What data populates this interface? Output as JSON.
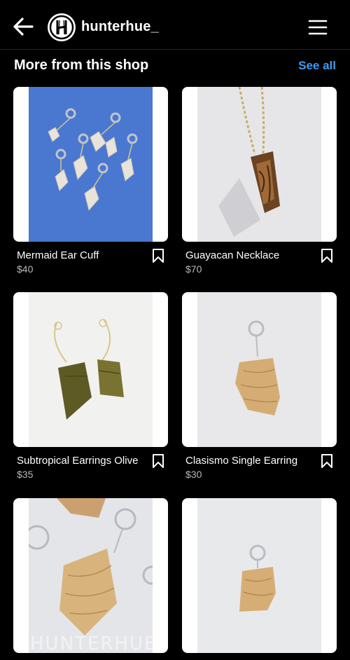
{
  "header": {
    "back_icon": "arrow-left-icon",
    "username": "hunterhue_",
    "avatar_icon": "shop-logo-icon",
    "menu_icon": "hamburger-menu-icon"
  },
  "section": {
    "title": "More from this shop",
    "see_all": "See all",
    "accent_color": "#3d9cf3"
  },
  "products": [
    {
      "name": "Mermaid Ear Cuff",
      "price": "$40",
      "save_icon": "bookmark-icon"
    },
    {
      "name": "Guayacan Necklace",
      "price": "$70",
      "save_icon": "bookmark-icon"
    },
    {
      "name": "Subtropical Earrings Olive",
      "price": "$35",
      "save_icon": "bookmark-icon"
    },
    {
      "name": "Clasismo Single Earring",
      "price": "$30",
      "save_icon": "bookmark-icon"
    },
    {
      "name": "",
      "price": "",
      "watermark": "HUNTERHUE"
    },
    {
      "name": "",
      "price": ""
    }
  ]
}
